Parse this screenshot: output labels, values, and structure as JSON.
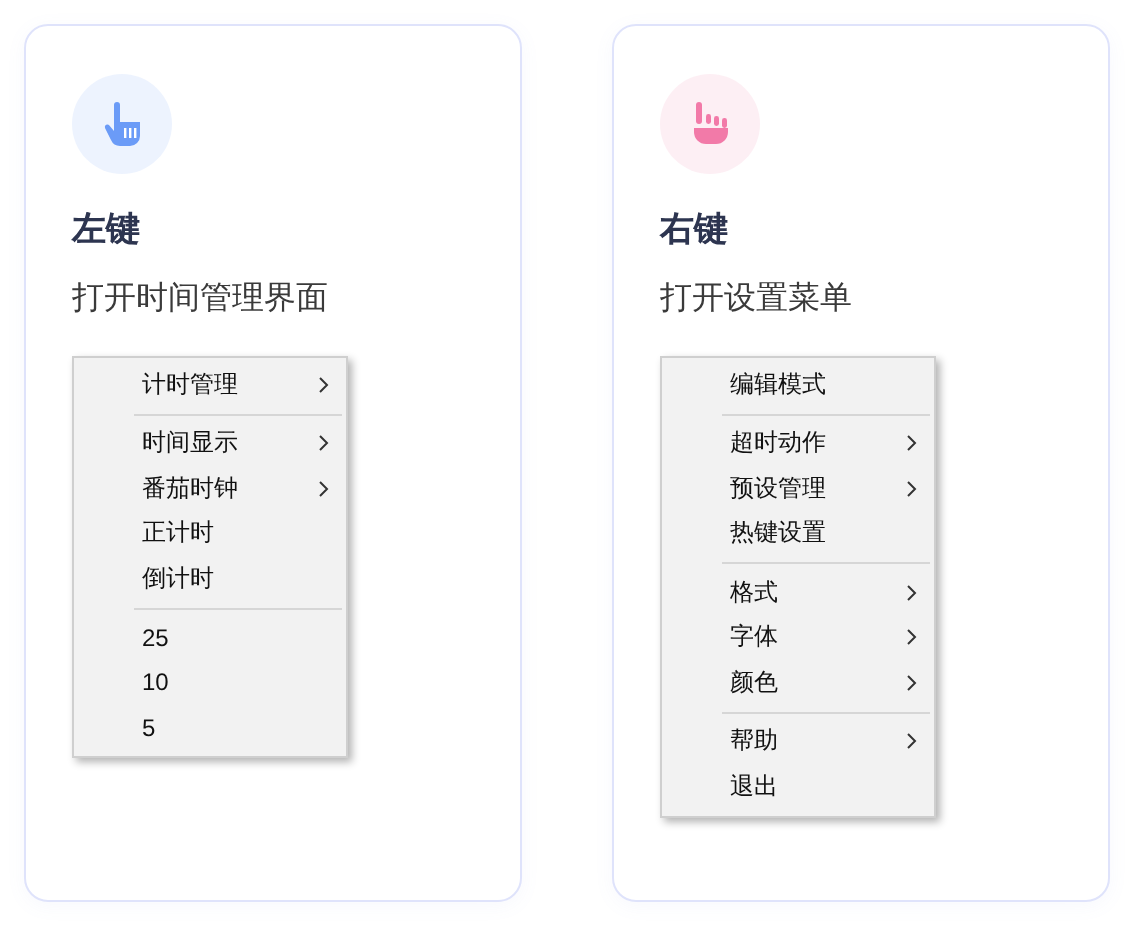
{
  "cards": [
    {
      "kind": "left-click",
      "color": "#6b9bf7",
      "title": "左键",
      "description": "打开时间管理界面",
      "menu": [
        {
          "kind": "item",
          "label": "计时管理",
          "submenu": true
        },
        {
          "kind": "separator"
        },
        {
          "kind": "item",
          "label": "时间显示",
          "submenu": true
        },
        {
          "kind": "item",
          "label": "番茄时钟",
          "submenu": true
        },
        {
          "kind": "item",
          "label": "正计时",
          "submenu": false
        },
        {
          "kind": "item",
          "label": "倒计时",
          "submenu": false
        },
        {
          "kind": "separator"
        },
        {
          "kind": "item",
          "label": "25",
          "submenu": false
        },
        {
          "kind": "item",
          "label": "10",
          "submenu": false
        },
        {
          "kind": "item",
          "label": "5",
          "submenu": false
        }
      ]
    },
    {
      "kind": "right-click",
      "color": "#f27aa8",
      "title": "右键",
      "description": "打开设置菜单",
      "menu": [
        {
          "kind": "item",
          "label": "编辑模式",
          "submenu": false
        },
        {
          "kind": "separator"
        },
        {
          "kind": "item",
          "label": "超时动作",
          "submenu": true
        },
        {
          "kind": "item",
          "label": "预设管理",
          "submenu": true
        },
        {
          "kind": "item",
          "label": "热键设置",
          "submenu": false
        },
        {
          "kind": "separator"
        },
        {
          "kind": "item",
          "label": "格式",
          "submenu": true
        },
        {
          "kind": "item",
          "label": "字体",
          "submenu": true
        },
        {
          "kind": "item",
          "label": "颜色",
          "submenu": true
        },
        {
          "kind": "separator"
        },
        {
          "kind": "item",
          "label": "帮助",
          "submenu": true
        },
        {
          "kind": "item",
          "label": "退出",
          "submenu": false
        }
      ]
    }
  ]
}
